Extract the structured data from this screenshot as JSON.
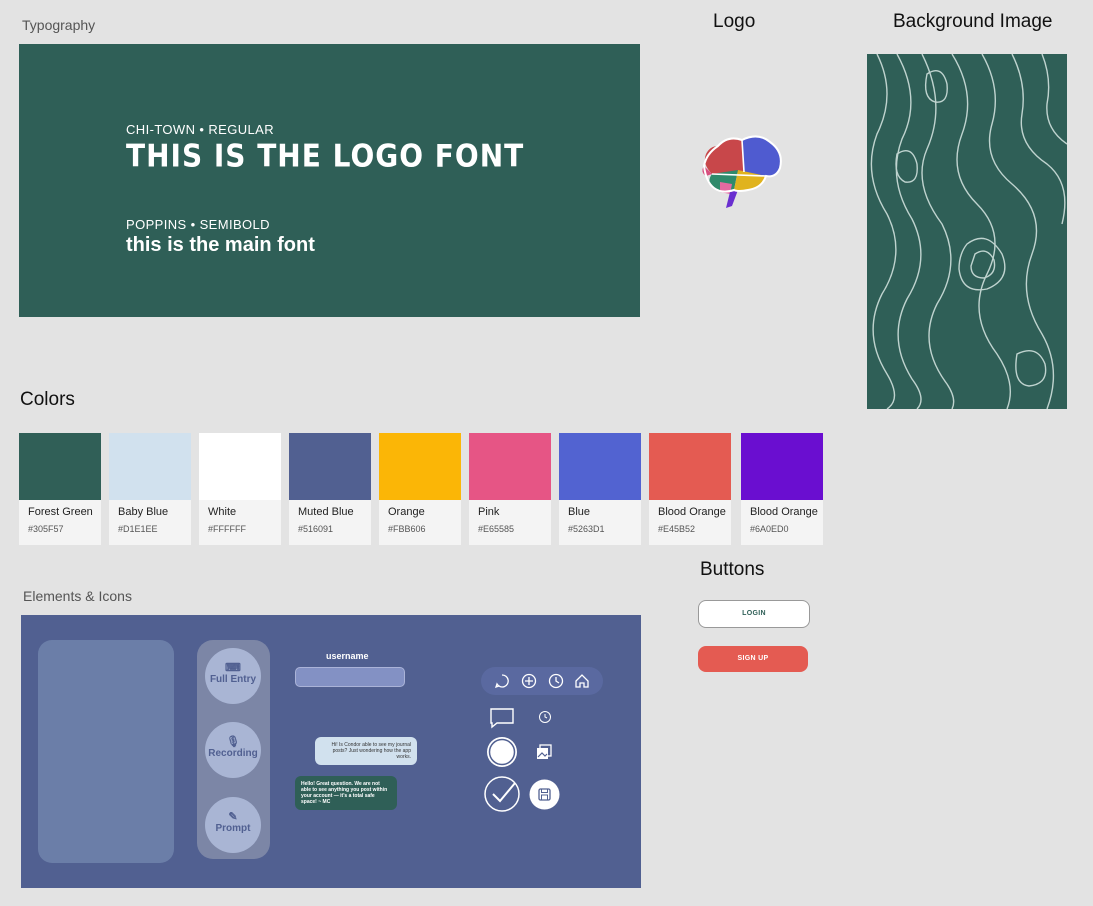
{
  "sections": {
    "typography": "Typography",
    "logo": "Logo",
    "background_image": "Background Image",
    "colors": "Colors",
    "elements_icons": "Elements & Icons",
    "buttons": "Buttons"
  },
  "typography": {
    "logo_font_label": "CHI-TOWN • REGULAR",
    "logo_font_sample": "THIS IS THE LOGO FONT",
    "main_font_label": "POPPINS • SEMIBOLD",
    "main_font_sample": "this is the main font"
  },
  "colors": [
    {
      "name": "Forest Green",
      "hex": "#305F57"
    },
    {
      "name": "Baby Blue",
      "hex": "#D1E1EE"
    },
    {
      "name": "White",
      "hex": "#FFFFFF"
    },
    {
      "name": "Muted Blue",
      "hex": "#516091"
    },
    {
      "name": "Orange",
      "hex": "#FBB606"
    },
    {
      "name": "Pink",
      "hex": "#E65585"
    },
    {
      "name": "Blue",
      "hex": "#5263D1"
    },
    {
      "name": "Blood Orange",
      "hex": "#E45B52"
    },
    {
      "name": "Blood Orange",
      "hex": "#6A0ED0"
    }
  ],
  "elements": {
    "full_entry": "Full Entry",
    "recording": "Recording",
    "prompt": "Prompt",
    "username_label": "username",
    "chat_incoming": "Hi! Is Condor able to see my journal posts? Just wondering how the app works.",
    "chat_outgoing": "Hello! Great question. We are not able to see anything you post within your account — it's a total safe space! ~ MC",
    "icons": [
      "chat-icon",
      "plus-circle-icon",
      "clock-icon",
      "home-icon",
      "speech-bubble-icon",
      "small-clock-icon",
      "record-icon",
      "gallery-icon",
      "check-icon",
      "save-icon"
    ]
  },
  "buttons": {
    "login": "LOGIN",
    "signup": "SIGN UP"
  }
}
